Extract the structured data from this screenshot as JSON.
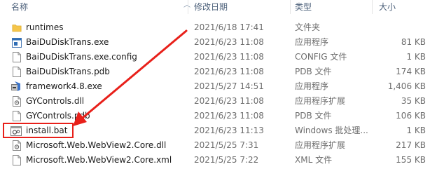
{
  "columns": {
    "name": "名称",
    "date": "修改日期",
    "type": "类型",
    "size": "大小"
  },
  "files": [
    {
      "icon": "folder-icon",
      "name": "runtimes",
      "date": "2021/6/18 17:41",
      "type": "文件夹",
      "size": ""
    },
    {
      "icon": "exe-app-icon",
      "name": "BaiDuDiskTrans.exe",
      "date": "2021/6/23 11:08",
      "type": "应用程序",
      "size": "81 KB"
    },
    {
      "icon": "document-icon",
      "name": "BaiDuDiskTrans.exe.config",
      "date": "2021/6/23 11:08",
      "type": "CONFIG 文件",
      "size": "1 KB"
    },
    {
      "icon": "document-icon",
      "name": "BaiDuDiskTrans.pdb",
      "date": "2021/6/23 11:08",
      "type": "PDB 文件",
      "size": "174 KB"
    },
    {
      "icon": "installer-icon",
      "name": "framework4.8.exe",
      "date": "2021/5/27 14:51",
      "type": "应用程序",
      "size": "1,406 KB"
    },
    {
      "icon": "dll-icon",
      "name": "GYControls.dll",
      "date": "2021/6/23 11:08",
      "type": "应用程序扩展",
      "size": "35 KB"
    },
    {
      "icon": "document-icon",
      "name": "GYControls.pdb",
      "date": "2021/6/23 11:08",
      "type": "PDB 文件",
      "size": "106 KB"
    },
    {
      "icon": "bat-gear-icon",
      "name": "install.bat",
      "date": "2021/6/23 11:13",
      "type": "Windows 批处理...",
      "size": "1 KB"
    },
    {
      "icon": "dll-icon",
      "name": "Microsoft.Web.WebView2.Core.dll",
      "date": "2021/5/25 7:31",
      "type": "应用程序扩展",
      "size": "217 KB"
    },
    {
      "icon": "document-icon",
      "name": "Microsoft.Web.WebView2.Core.xml",
      "date": "2021/5/25 7:22",
      "type": "XML 文件",
      "size": "155 KB"
    }
  ],
  "annotation": {
    "color": "#e8201a"
  }
}
